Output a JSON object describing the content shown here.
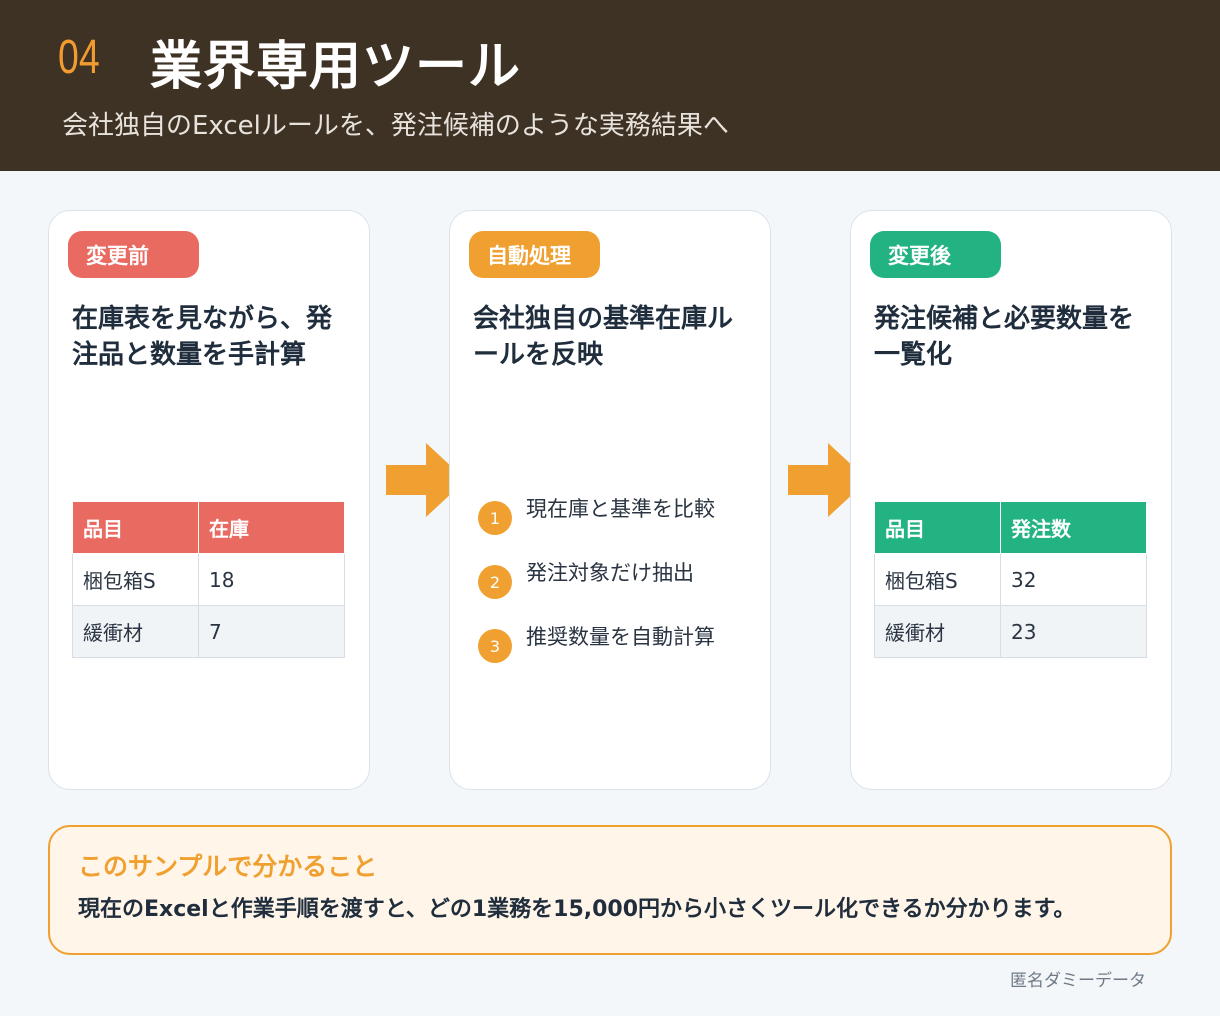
{
  "header": {
    "number": "04",
    "title": "業界専用ツール",
    "subtitle": "会社独自のExcelルールを、発注候補のような実務結果へ"
  },
  "cards": [
    {
      "pill": "変更前",
      "title": "在庫表を見ながら、発注品と数量を手計算",
      "table": {
        "headers": [
          "品目",
          "在庫"
        ],
        "rows": [
          [
            "梱包箱S",
            "18"
          ],
          [
            "緩衝材",
            "7"
          ]
        ]
      }
    },
    {
      "pill": "自動処理",
      "title": "会社独自の基準在庫ルールを反映",
      "steps": [
        {
          "num": "1",
          "text": "現在庫と基準を比較"
        },
        {
          "num": "2",
          "text": "発注対象だけ抽出"
        },
        {
          "num": "3",
          "text": "推奨数量を自動計算"
        }
      ]
    },
    {
      "pill": "変更後",
      "title": "発注候補と必要数量を一覧化",
      "table": {
        "headers": [
          "品目",
          "発注数"
        ],
        "rows": [
          [
            "梱包箱S",
            "32"
          ],
          [
            "緩衝材",
            "23"
          ]
        ]
      }
    }
  ],
  "note": {
    "title": "このサンプルで分かること",
    "text": "現在のExcelと作業手順を渡すと、どの1業務を15,000円から小さくツール化できるか分かります。"
  },
  "footer": "匿名ダミーデータ",
  "colors": {
    "header_bg": "#3e3224",
    "accent_orange": "#f0a030",
    "before_red": "#e86a60",
    "after_green": "#23b383"
  }
}
